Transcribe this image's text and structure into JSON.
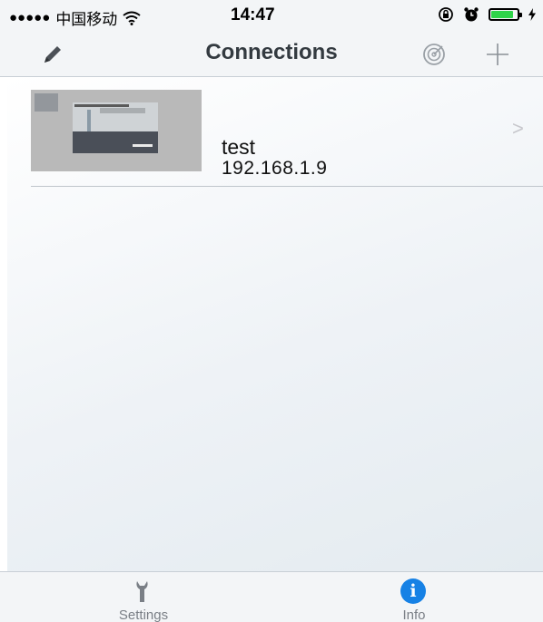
{
  "status_bar": {
    "carrier": "中国移动",
    "time": "14:47",
    "battery_level": 0.85
  },
  "nav": {
    "title": "Connections",
    "icons": [
      "pencil-icon",
      "radar-icon",
      "plus-icon"
    ]
  },
  "connections": [
    {
      "name": "test",
      "ip": "192.168.1.9"
    }
  ],
  "tabs": [
    {
      "label": "Settings",
      "icon": "wrench-icon"
    },
    {
      "label": "Info",
      "icon": "info-icon"
    }
  ],
  "colors": {
    "accent": "#1681e5",
    "chevron": "#c7c7cc",
    "battery": "#2fd44a"
  }
}
